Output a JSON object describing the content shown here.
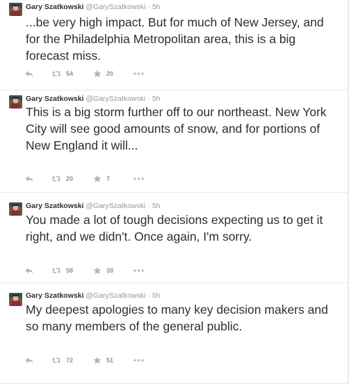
{
  "tweets": [
    {
      "name": "Gary Szatkowski",
      "handle": "@GarySzatkowski",
      "time": "5h",
      "text": "...be very high impact.  But for much of New Jersey, and for the Philadelphia Metropolitan area, this is a big forecast miss.",
      "retweets": "54",
      "favorites": "20"
    },
    {
      "name": "Gary Szatkowski",
      "handle": "@GarySzatkowski",
      "time": "5h",
      "text": "This is a big storm further off to our northeast.  New York City will see good amounts of snow, and for portions of New England it will...",
      "retweets": "20",
      "favorites": "7"
    },
    {
      "name": "Gary Szatkowski",
      "handle": "@GarySzatkowski",
      "time": "5h",
      "text": "You made a lot of tough decisions expecting us to get it right, and we didn't.  Once again, I'm sorry.",
      "retweets": "58",
      "favorites": "38"
    },
    {
      "name": "Gary Szatkowski",
      "handle": "@GarySzatkowski",
      "time": "5h",
      "text": "My deepest apologies to many key decision makers and so many members of the general public.",
      "retweets": "72",
      "favorites": "51"
    }
  ],
  "separator": "·",
  "icons": {
    "reply": "reply-icon",
    "retweet": "retweet-icon",
    "favorite": "star-icon",
    "more": "more-icon"
  },
  "colors": {
    "name": "#292f33",
    "meta": "#8899a6",
    "icon": "#aab8c2",
    "border": "#e1e8ed"
  }
}
